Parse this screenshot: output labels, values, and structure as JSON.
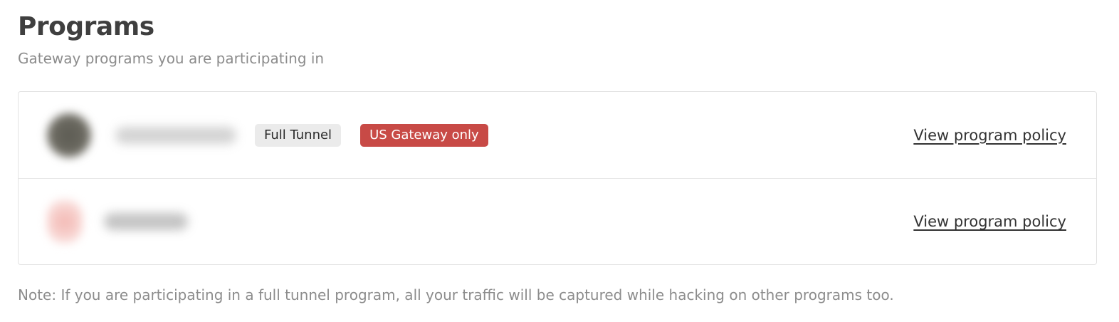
{
  "header": {
    "title": "Programs",
    "subtitle": "Gateway programs you are participating in"
  },
  "programs": [
    {
      "avatar_icon": "program-logo-icon",
      "badges": {
        "tunnel": "Full Tunnel",
        "gateway": "US Gateway only"
      },
      "policy_link": "View program policy"
    },
    {
      "avatar_icon": "program-logo-icon",
      "policy_link": "View program policy"
    }
  ],
  "note": "Note: If you are participating in a full tunnel program, all your traffic will be captured while hacking on other programs too.",
  "colors": {
    "gateway_badge": "#c84a46",
    "tunnel_badge": "#ebebeb"
  }
}
